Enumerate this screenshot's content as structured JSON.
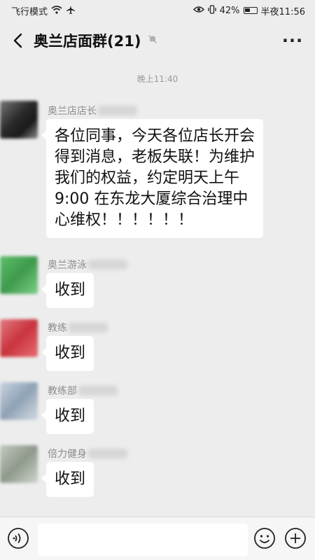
{
  "status_bar": {
    "left_text": "飞行模式",
    "wifi_icon": "wifi-icon",
    "airplane_icon": "airplane-icon",
    "eye_icon": "eye-icon",
    "vibrate_icon": "vibrate-icon",
    "battery_percent": "42%",
    "battery_icon": "battery-icon",
    "time": "半夜11:56"
  },
  "header": {
    "back_icon": "chevron-left-icon",
    "title": "奥兰店面群(21)",
    "mute_icon": "mute-bell-icon",
    "more_label": "···"
  },
  "chat": {
    "timestamp": "晚上11:40",
    "messages": [
      {
        "sender": "奥兰店店长",
        "text": "各位同事，今天各位店长开会得到消息，老板失联！为维护我们的权益，约定明天上午 9:00 在东龙大厦综合治理中心维权！！！！！！",
        "avatar_color": "#3a3a3a"
      },
      {
        "sender": "奥兰游泳",
        "text": "收到",
        "avatar_color": "#4cae5b"
      },
      {
        "sender": "教练",
        "text": "收到",
        "avatar_color": "#d9535a"
      },
      {
        "sender": "教练部",
        "text": "收到",
        "avatar_color": "#9fb0c3"
      },
      {
        "sender": "倍力健身",
        "text": "收到",
        "avatar_color": "#a7b0a4"
      }
    ]
  },
  "input_bar": {
    "voice_icon": "voice-icon",
    "input_value": "",
    "emoji_icon": "emoji-icon",
    "plus_icon": "plus-circle-icon"
  },
  "colors": {
    "background": "#ededed",
    "bubble": "#ffffff",
    "input_bar": "#f6f6f6"
  }
}
